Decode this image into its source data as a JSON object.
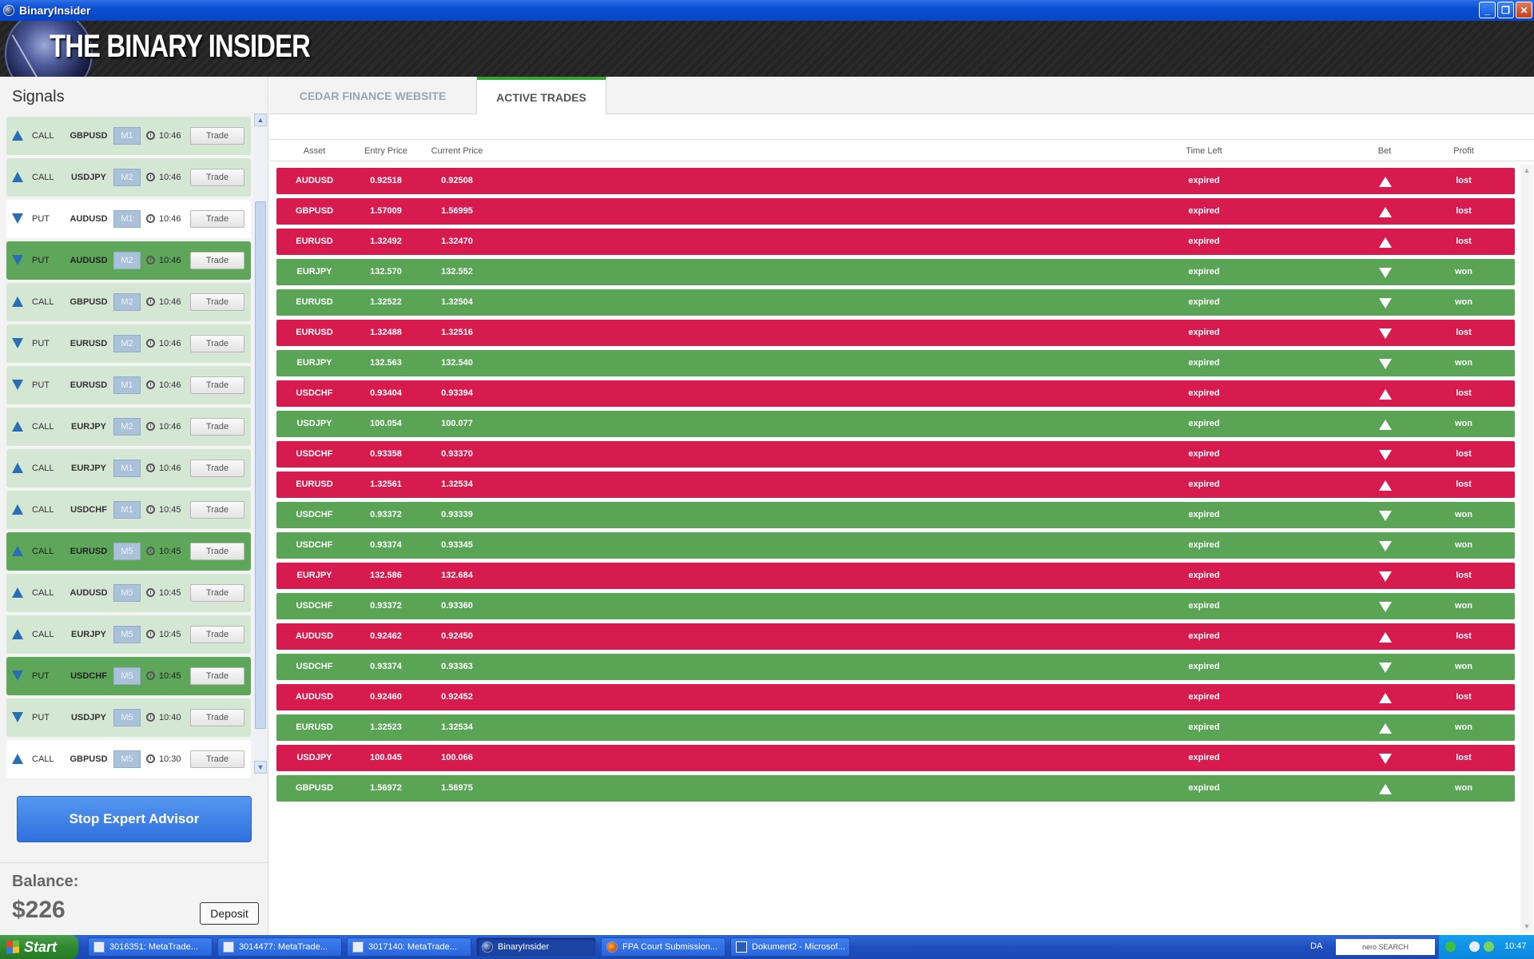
{
  "window": {
    "title": "BinaryInsider",
    "min": "_",
    "max": "❐",
    "close": "✕"
  },
  "header": {
    "logo_text": "THE BINARY INSIDER"
  },
  "signals": {
    "title": "Signals",
    "trade_label": "Trade",
    "items": [
      {
        "dir": "CALL",
        "arrow": "up",
        "asset": "GBPUSD",
        "tf": "M1",
        "time": "10:46",
        "tone": "t-light"
      },
      {
        "dir": "CALL",
        "arrow": "up",
        "asset": "USDJPY",
        "tf": "M2",
        "time": "10:46",
        "tone": "t-light"
      },
      {
        "dir": "PUT",
        "arrow": "down",
        "asset": "AUDUSD",
        "tf": "M1",
        "time": "10:46",
        "tone": "t-white"
      },
      {
        "dir": "PUT",
        "arrow": "down",
        "asset": "AUDUSD",
        "tf": "M2",
        "time": "10:46",
        "tone": "t-dark"
      },
      {
        "dir": "CALL",
        "arrow": "up",
        "asset": "GBPUSD",
        "tf": "M2",
        "time": "10:46",
        "tone": "t-light"
      },
      {
        "dir": "PUT",
        "arrow": "down",
        "asset": "EURUSD",
        "tf": "M2",
        "time": "10:46",
        "tone": "t-light"
      },
      {
        "dir": "PUT",
        "arrow": "down",
        "asset": "EURUSD",
        "tf": "M1",
        "time": "10:46",
        "tone": "t-light"
      },
      {
        "dir": "CALL",
        "arrow": "up",
        "asset": "EURJPY",
        "tf": "M2",
        "time": "10:46",
        "tone": "t-light"
      },
      {
        "dir": "CALL",
        "arrow": "up",
        "asset": "EURJPY",
        "tf": "M1",
        "time": "10:46",
        "tone": "t-light"
      },
      {
        "dir": "CALL",
        "arrow": "up",
        "asset": "USDCHF",
        "tf": "M1",
        "time": "10:45",
        "tone": "t-light"
      },
      {
        "dir": "CALL",
        "arrow": "up",
        "asset": "EURUSD",
        "tf": "M5",
        "time": "10:45",
        "tone": "t-dark"
      },
      {
        "dir": "CALL",
        "arrow": "up",
        "asset": "AUDUSD",
        "tf": "M5",
        "time": "10:45",
        "tone": "t-light"
      },
      {
        "dir": "CALL",
        "arrow": "up",
        "asset": "EURJPY",
        "tf": "M5",
        "time": "10:45",
        "tone": "t-light"
      },
      {
        "dir": "PUT",
        "arrow": "down",
        "asset": "USDCHF",
        "tf": "M5",
        "time": "10:45",
        "tone": "t-dark"
      },
      {
        "dir": "PUT",
        "arrow": "down",
        "asset": "USDJPY",
        "tf": "M5",
        "time": "10:40",
        "tone": "t-light"
      },
      {
        "dir": "CALL",
        "arrow": "up",
        "asset": "GBPUSD",
        "tf": "M5",
        "time": "10:30",
        "tone": "t-white"
      }
    ]
  },
  "stop_button": "Stop Expert Advisor",
  "balance": {
    "label": "Balance:",
    "value": "$226",
    "deposit": "Deposit"
  },
  "tabs": [
    {
      "label": "CEDAR FINANCE WEBSITE",
      "active": false
    },
    {
      "label": "ACTIVE TRADES",
      "active": true
    }
  ],
  "table": {
    "headers": {
      "asset": "Asset",
      "entry": "Entry Price",
      "current": "Current Price",
      "time_left": "Time Left",
      "bet": "Bet",
      "profit": "Profit"
    },
    "rows": [
      {
        "asset": "AUDUSD",
        "entry": "0.92518",
        "current": "0.92508",
        "time_left": "expired",
        "bet": "up",
        "profit": "lost"
      },
      {
        "asset": "GBPUSD",
        "entry": "1.57009",
        "current": "1.56995",
        "time_left": "expired",
        "bet": "up",
        "profit": "lost"
      },
      {
        "asset": "EURUSD",
        "entry": "1.32492",
        "current": "1.32470",
        "time_left": "expired",
        "bet": "up",
        "profit": "lost"
      },
      {
        "asset": "EURJPY",
        "entry": "132.570",
        "current": "132.552",
        "time_left": "expired",
        "bet": "down",
        "profit": "won"
      },
      {
        "asset": "EURUSD",
        "entry": "1.32522",
        "current": "1.32504",
        "time_left": "expired",
        "bet": "down",
        "profit": "won"
      },
      {
        "asset": "EURUSD",
        "entry": "1.32488",
        "current": "1.32516",
        "time_left": "expired",
        "bet": "down",
        "profit": "lost"
      },
      {
        "asset": "EURJPY",
        "entry": "132.563",
        "current": "132.540",
        "time_left": "expired",
        "bet": "down",
        "profit": "won"
      },
      {
        "asset": "USDCHF",
        "entry": "0.93404",
        "current": "0.93394",
        "time_left": "expired",
        "bet": "up",
        "profit": "lost"
      },
      {
        "asset": "USDJPY",
        "entry": "100.054",
        "current": "100.077",
        "time_left": "expired",
        "bet": "up",
        "profit": "won"
      },
      {
        "asset": "USDCHF",
        "entry": "0.93358",
        "current": "0.93370",
        "time_left": "expired",
        "bet": "down",
        "profit": "lost"
      },
      {
        "asset": "EURUSD",
        "entry": "1.32561",
        "current": "1.32534",
        "time_left": "expired",
        "bet": "up",
        "profit": "lost"
      },
      {
        "asset": "USDCHF",
        "entry": "0.93372",
        "current": "0.93339",
        "time_left": "expired",
        "bet": "down",
        "profit": "won"
      },
      {
        "asset": "USDCHF",
        "entry": "0.93374",
        "current": "0.93345",
        "time_left": "expired",
        "bet": "down",
        "profit": "won"
      },
      {
        "asset": "EURJPY",
        "entry": "132.586",
        "current": "132.684",
        "time_left": "expired",
        "bet": "down",
        "profit": "lost"
      },
      {
        "asset": "USDCHF",
        "entry": "0.93372",
        "current": "0.93360",
        "time_left": "expired",
        "bet": "down",
        "profit": "won"
      },
      {
        "asset": "AUDUSD",
        "entry": "0.92462",
        "current": "0.92450",
        "time_left": "expired",
        "bet": "up",
        "profit": "lost"
      },
      {
        "asset": "USDCHF",
        "entry": "0.93374",
        "current": "0.93363",
        "time_left": "expired",
        "bet": "down",
        "profit": "won"
      },
      {
        "asset": "AUDUSD",
        "entry": "0.92460",
        "current": "0.92452",
        "time_left": "expired",
        "bet": "up",
        "profit": "lost"
      },
      {
        "asset": "EURUSD",
        "entry": "1.32523",
        "current": "1.32534",
        "time_left": "expired",
        "bet": "up",
        "profit": "won"
      },
      {
        "asset": "USDJPY",
        "entry": "100.045",
        "current": "100.066",
        "time_left": "expired",
        "bet": "down",
        "profit": "lost"
      },
      {
        "asset": "GBPUSD",
        "entry": "1.56972",
        "current": "1.56975",
        "time_left": "expired",
        "bet": "up",
        "profit": "won"
      }
    ]
  },
  "taskbar": {
    "start": "Start",
    "tasks": [
      {
        "label": "3016351: MetaTrade...",
        "icon": "metatrader-icon",
        "active": false
      },
      {
        "label": "3014477: MetaTrade...",
        "icon": "metatrader-icon",
        "active": false
      },
      {
        "label": "3017140: MetaTrade...",
        "icon": "metatrader-icon",
        "active": false
      },
      {
        "label": "BinaryInsider",
        "icon": "binaryinsider-icon",
        "active": true
      },
      {
        "label": "FPA Court Submission...",
        "icon": "firefox-icon",
        "active": false
      },
      {
        "label": "Dokument2 - Microsof...",
        "icon": "word-icon",
        "active": false
      }
    ],
    "lang": "DA",
    "nero": "nero SEARCH",
    "clock": "10:47"
  }
}
